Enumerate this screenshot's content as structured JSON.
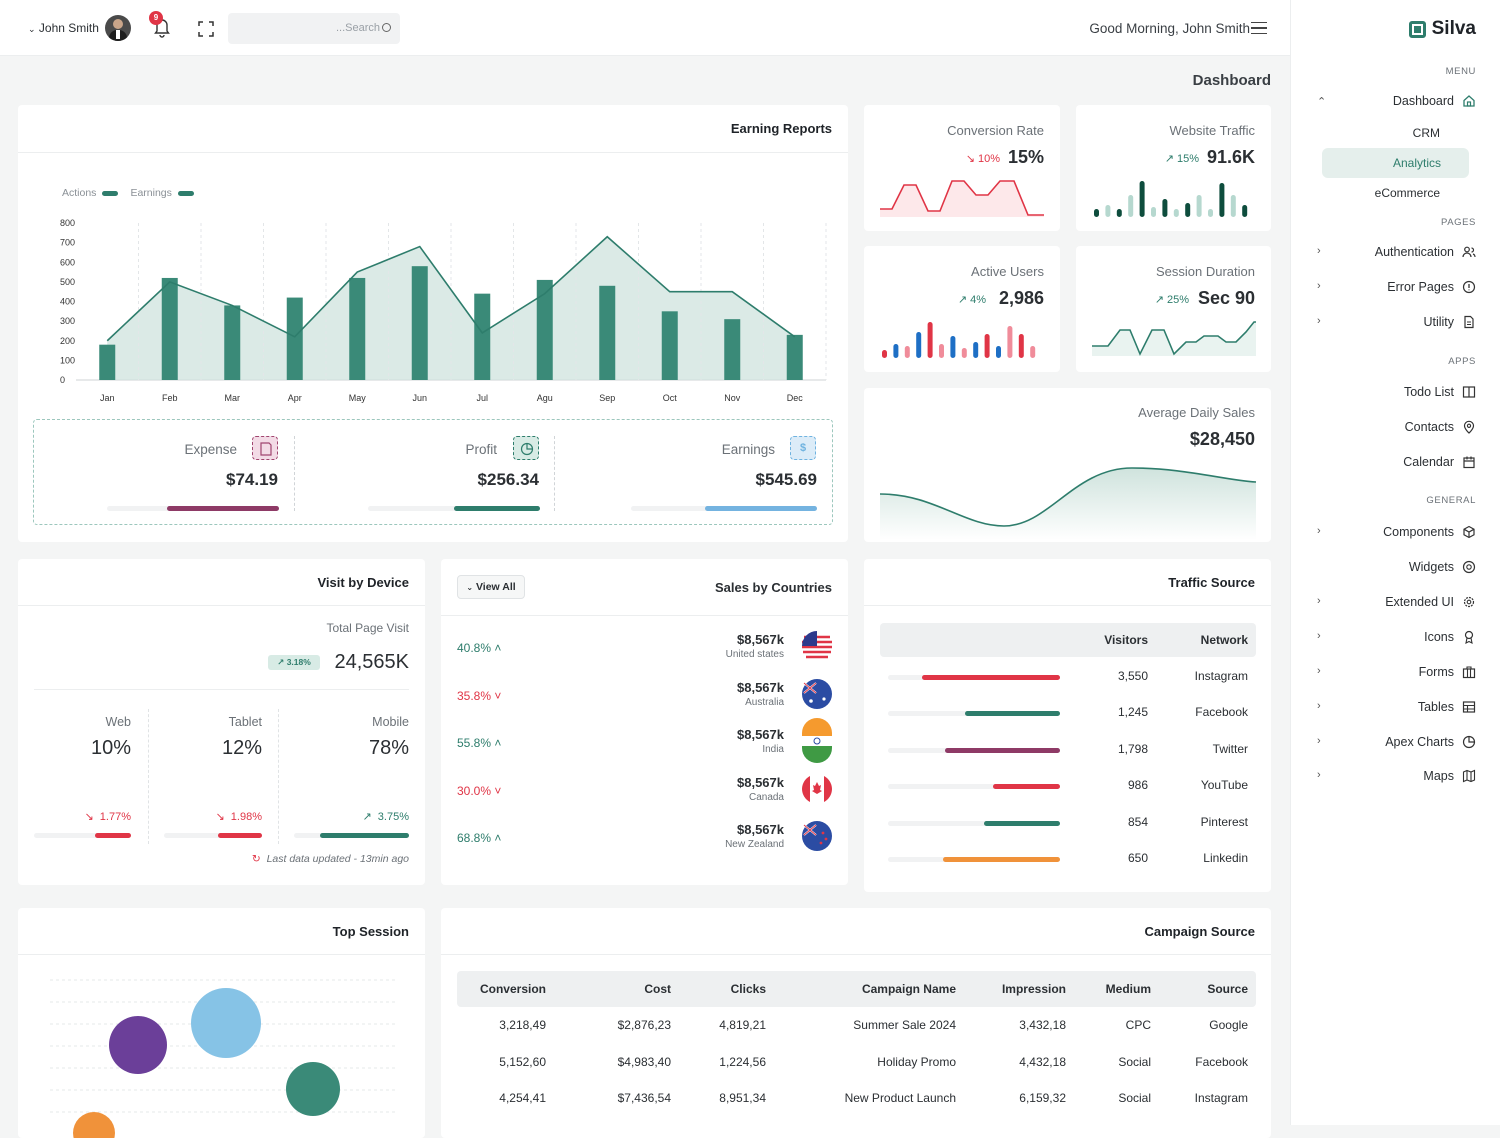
{
  "topbar": {
    "user_name": "John Smith",
    "notif_count": "9",
    "search_placeholder": "...Search",
    "greeting": "Good Morning, John Smith"
  },
  "page_title": "Dashboard",
  "sidebar": {
    "logo": "Silva",
    "menu_label": "MENU",
    "dashboard": "Dashboard",
    "sub": [
      "CRM",
      "Analytics",
      "eCommerce"
    ],
    "pages_label": "PAGES",
    "pages": [
      "Authentication",
      "Error Pages",
      "Utility"
    ],
    "apps_label": "APPS",
    "apps": [
      "Todo List",
      "Contacts",
      "Calendar"
    ],
    "general_label": "GENERAL",
    "general": [
      "Components",
      "Widgets",
      "Extended UI",
      "Icons",
      "Forms",
      "Tables",
      "Apex Charts",
      "Maps"
    ]
  },
  "earning": {
    "title": "Earning Reports",
    "legend": [
      "Actions",
      "Earnings"
    ],
    "expense_label": "Expense",
    "expense_value": "$74.19",
    "expense_progress": 0.65,
    "profit_label": "Profit",
    "profit_value": "$256.34",
    "profit_progress": 0.5,
    "earnings_label": "Earnings",
    "earnings_value": "$545.69",
    "earnings_progress": 0.6
  },
  "chart_data": {
    "type": "bar",
    "categories": [
      "Jan",
      "Feb",
      "Mar",
      "Apr",
      "May",
      "Jun",
      "Jul",
      "Agu",
      "Sep",
      "Oct",
      "Nov",
      "Dec"
    ],
    "series": [
      {
        "name": "Actions",
        "values": [
          180,
          520,
          380,
          420,
          520,
          580,
          440,
          510,
          480,
          350,
          310,
          230
        ]
      },
      {
        "name": "Earnings",
        "values": [
          200,
          500,
          380,
          220,
          550,
          680,
          240,
          440,
          730,
          450,
          450,
          220
        ]
      }
    ],
    "ylim": [
      0,
      800
    ],
    "yticks": [
      "800",
      "700",
      "600",
      "500",
      "400",
      "300",
      "200",
      "100",
      "0"
    ],
    "colors": {
      "bar": "#3a8a78",
      "area": "#cfe3dd",
      "line": "#2e7d6c"
    }
  },
  "stats": {
    "conversion": {
      "label": "Conversion Rate",
      "pct": "10%",
      "value": "15%"
    },
    "traffic": {
      "label": "Website Traffic",
      "pct": "15%",
      "value": "91.6K"
    },
    "active": {
      "label": "Active Users",
      "pct": "4%",
      "value": "2,986"
    },
    "session": {
      "label": "Session Duration",
      "pct": "25%",
      "value": "Sec 90"
    },
    "avg_sales": {
      "label": "Average Daily Sales",
      "value": "$28,450"
    }
  },
  "device": {
    "title": "Visit by Device",
    "total_label": "Total Page Visit",
    "badge": "3.18%",
    "total": "24,565K",
    "cols": [
      {
        "label": "Web",
        "value": "10%",
        "change": "1.77%"
      },
      {
        "label": "Tablet",
        "value": "12%",
        "change": "1.98%"
      },
      {
        "label": "Mobile",
        "value": "78%",
        "change": "3.75%"
      }
    ],
    "updated": "Last data updated - 13min ago"
  },
  "countries": {
    "title": "Sales by Countries",
    "view_all": "View All",
    "rows": [
      {
        "pct": "40.8%",
        "amount": "$8,567k",
        "name": "United states"
      },
      {
        "pct": "35.8%",
        "amount": "$8,567k",
        "name": "Australia"
      },
      {
        "pct": "55.8%",
        "amount": "$8,567k",
        "name": "India"
      },
      {
        "pct": "30.0%",
        "amount": "$8,567k",
        "name": "Canada"
      },
      {
        "pct": "68.8%",
        "amount": "$8,567k",
        "name": "New Zealand"
      }
    ]
  },
  "traffic_source": {
    "title": "Traffic Source",
    "headers": [
      "Visitors",
      "Network"
    ],
    "rows": [
      {
        "visitors": "3,550",
        "network": "Instagram",
        "share": 0.8,
        "color": "#e03546"
      },
      {
        "visitors": "1,245",
        "network": "Facebook",
        "share": 0.55,
        "color": "#2e7d6c"
      },
      {
        "visitors": "1,798",
        "network": "Twitter",
        "share": 0.67,
        "color": "#8e3a66"
      },
      {
        "visitors": "986",
        "network": "YouTube",
        "share": 0.39,
        "color": "#e03546"
      },
      {
        "visitors": "854",
        "network": "Pinterest",
        "share": 0.44,
        "color": "#2e7d6c"
      },
      {
        "visitors": "650",
        "network": "Linkedin",
        "share": 0.68,
        "color": "#f0923a"
      }
    ]
  },
  "top_session": {
    "title": "Top Session"
  },
  "campaign": {
    "title": "Campaign Source",
    "headers": [
      "Conversion",
      "Cost",
      "Clicks",
      "Campaign Name",
      "Impression",
      "Medium",
      "Source"
    ],
    "rows": [
      [
        "3,218,49",
        "$2,876,23",
        "4,819,21",
        "Summer Sale 2024",
        "3,432,18",
        "CPC",
        "Google"
      ],
      [
        "5,152,60",
        "$4,983,40",
        "1,224,56",
        "Holiday Promo",
        "4,432,18",
        "Social",
        "Facebook"
      ],
      [
        "4,254,41",
        "$7,436,54",
        "8,951,34",
        "New Product Launch",
        "6,159,32",
        "Social",
        "Instagram"
      ]
    ]
  }
}
